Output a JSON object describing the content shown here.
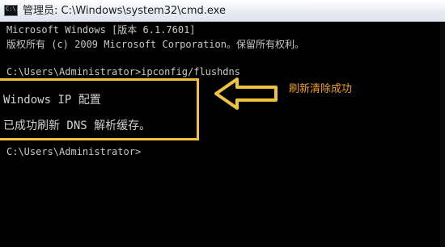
{
  "window": {
    "title": "管理员: C:\\Windows\\system32\\cmd.exe",
    "icon": "cmd-icon",
    "icon_label": "C:\\."
  },
  "console": {
    "lines": [
      "Microsoft Windows [版本 6.1.7601]",
      "版权所有 (c) 2009 Microsoft Corporation。保留所有权利。",
      "",
      "C:\\Users\\Administrator>ipconfig/flushdns",
      "Windows IP 配置",
      "已成功刷新 DNS 解析缓存。",
      "C:\\Users\\Administrator>"
    ]
  },
  "annotation": {
    "text": "刷新清除成功",
    "color": "#f0a020",
    "box_color": "#f0c23b",
    "arrow": "left-arrow-icon"
  }
}
